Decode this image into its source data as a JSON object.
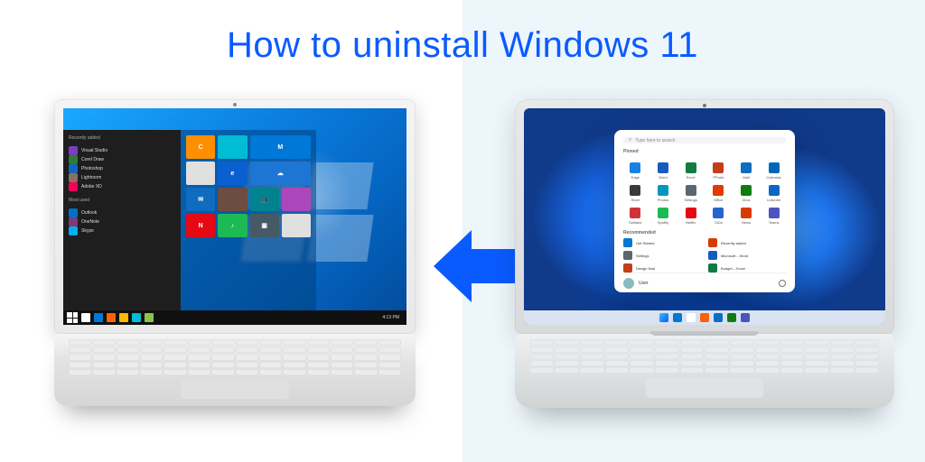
{
  "title": "How to uninstall Windows 11",
  "arrow": {
    "direction": "left",
    "color": "#0a5bff"
  },
  "win10": {
    "start_header": "Recently added",
    "recent": [
      {
        "label": "Visual Studio",
        "color": "#7a3fbf"
      },
      {
        "label": "Corel Draw",
        "color": "#2e7d32"
      },
      {
        "label": "Photoshop",
        "color": "#1565c0"
      },
      {
        "label": "Lightroom",
        "color": "#8d6e63"
      },
      {
        "label": "Adobe XD",
        "color": "#f50057"
      }
    ],
    "most_header": "Most used",
    "most": [
      {
        "label": "Outlook",
        "color": "#0072c6"
      },
      {
        "label": "OneNote",
        "color": "#80397b"
      },
      {
        "label": "Skype",
        "color": "#00aff0"
      }
    ],
    "tiles": [
      {
        "label": "C",
        "color": "#ff8f00"
      },
      {
        "label": "",
        "color": "#00bcd4"
      },
      {
        "label": "M",
        "color": "#0078d7",
        "wide": true
      },
      {
        "label": "",
        "color": "#e0e0e0"
      },
      {
        "label": "e",
        "color": "#0b60d1"
      },
      {
        "label": "☁",
        "color": "#1d76d3",
        "wide": true
      },
      {
        "label": "✉",
        "color": "#0f6cbf"
      },
      {
        "label": "",
        "color": "#6d4c41"
      },
      {
        "label": "📺",
        "color": "#00838f"
      },
      {
        "label": "",
        "color": "#ab47bc"
      },
      {
        "label": "N",
        "color": "#e50914"
      },
      {
        "label": "♪",
        "color": "#1db954"
      },
      {
        "label": "▣",
        "color": "#455a64"
      },
      {
        "label": "",
        "color": "#e0e0e0"
      }
    ],
    "taskbar_icons": [
      "#ffffff",
      "#0078d7",
      "#f7630c",
      "#ffb900",
      "#00bcd4",
      "#8bc34a"
    ],
    "clock": "4:13 PM"
  },
  "win11": {
    "search_placeholder": "Type here to search",
    "pinned_label": "Pinned",
    "pinned": [
      {
        "label": "Edge",
        "color": "#1b80e4"
      },
      {
        "label": "Word",
        "color": "#185abd"
      },
      {
        "label": "Excel",
        "color": "#107c41"
      },
      {
        "label": "PPoint",
        "color": "#c43e1c"
      },
      {
        "label": "Mail",
        "color": "#0f6cbf"
      },
      {
        "label": "Calendar",
        "color": "#0067b8"
      },
      {
        "label": "Store",
        "color": "#3a3a3a"
      },
      {
        "label": "Photos",
        "color": "#0099bc"
      },
      {
        "label": "Settings",
        "color": "#5b6770"
      },
      {
        "label": "Office",
        "color": "#e03c00"
      },
      {
        "label": "Xbox",
        "color": "#107c10"
      },
      {
        "label": "LinkedIn",
        "color": "#0a66c2"
      },
      {
        "label": "Solitaire",
        "color": "#d13438"
      },
      {
        "label": "Spotify",
        "color": "#1db954"
      },
      {
        "label": "Netflix",
        "color": "#e50914"
      },
      {
        "label": "ToDo",
        "color": "#2564cf"
      },
      {
        "label": "News",
        "color": "#d83b01"
      },
      {
        "label": "Teams",
        "color": "#4b53bc"
      }
    ],
    "recommended_label": "Recommended",
    "recommended": [
      {
        "label": "Get Started",
        "color": "#0078d4"
      },
      {
        "label": "Recently added",
        "color": "#d83b01"
      },
      {
        "label": "Settings",
        "color": "#5b6770"
      },
      {
        "label": "Microsoft – Word",
        "color": "#185abd"
      },
      {
        "label": "Design final",
        "color": "#c43e1c"
      },
      {
        "label": "Budget – Excel",
        "color": "#107c41"
      }
    ],
    "user_name": "User",
    "taskbar_icons": [
      "#0078d4",
      "#ffffff",
      "#f7630c",
      "#0f6cbf",
      "#107c10",
      "#4b53bc"
    ]
  }
}
